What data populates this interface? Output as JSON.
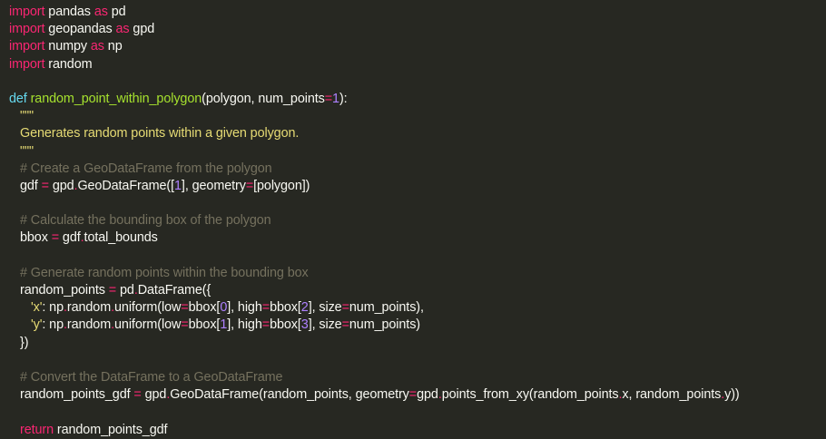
{
  "colors": {
    "background": "#272822",
    "text": "#f8f8f2",
    "keyword": "#f92672",
    "definition": "#66d9ef",
    "function": "#a6e22e",
    "number": "#ae81ff",
    "string": "#e6db74",
    "comment": "#75715e"
  },
  "lines": [
    [
      {
        "c": "kw",
        "t": "import"
      },
      {
        "c": "pl",
        "t": " pandas "
      },
      {
        "c": "kw",
        "t": "as"
      },
      {
        "c": "pl",
        "t": " pd"
      }
    ],
    [
      {
        "c": "kw",
        "t": "import"
      },
      {
        "c": "pl",
        "t": " geopandas "
      },
      {
        "c": "kw",
        "t": "as"
      },
      {
        "c": "pl",
        "t": " gpd"
      }
    ],
    [
      {
        "c": "kw",
        "t": "import"
      },
      {
        "c": "pl",
        "t": " numpy "
      },
      {
        "c": "kw",
        "t": "as"
      },
      {
        "c": "pl",
        "t": " np"
      }
    ],
    [
      {
        "c": "kw",
        "t": "import"
      },
      {
        "c": "pl",
        "t": " random"
      }
    ],
    [],
    [
      {
        "c": "def",
        "t": "def "
      },
      {
        "c": "fn",
        "t": "random_point_within_polygon"
      },
      {
        "c": "pl",
        "t": "(polygon, num_points"
      },
      {
        "c": "op",
        "t": "="
      },
      {
        "c": "num",
        "t": "1"
      },
      {
        "c": "pl",
        "t": "):"
      }
    ],
    [
      {
        "c": "str",
        "t": "\"\"\"",
        "i": 1
      }
    ],
    [
      {
        "c": "str",
        "t": "Generates random points within a given polygon.",
        "i": 1
      }
    ],
    [
      {
        "c": "str",
        "t": "\"\"\"",
        "i": 1
      }
    ],
    [
      {
        "c": "cm",
        "t": "# Create a GeoDataFrame from the polygon",
        "i": 1
      }
    ],
    [
      {
        "c": "pl",
        "t": "gdf ",
        "i": 1
      },
      {
        "c": "op",
        "t": "="
      },
      {
        "c": "pl",
        "t": " gpd"
      },
      {
        "c": "op",
        "t": "."
      },
      {
        "c": "pl",
        "t": "GeoDataFrame(["
      },
      {
        "c": "num",
        "t": "1"
      },
      {
        "c": "pl",
        "t": "], geometry"
      },
      {
        "c": "op",
        "t": "="
      },
      {
        "c": "pl",
        "t": "[polygon])"
      }
    ],
    [],
    [
      {
        "c": "cm",
        "t": "# Calculate the bounding box of the polygon",
        "i": 1
      }
    ],
    [
      {
        "c": "pl",
        "t": "bbox ",
        "i": 1
      },
      {
        "c": "op",
        "t": "="
      },
      {
        "c": "pl",
        "t": " gdf"
      },
      {
        "c": "op",
        "t": "."
      },
      {
        "c": "pl",
        "t": "total_bounds"
      }
    ],
    [],
    [
      {
        "c": "cm",
        "t": "# Generate random points within the bounding box",
        "i": 1
      }
    ],
    [
      {
        "c": "pl",
        "t": "random_points ",
        "i": 1
      },
      {
        "c": "op",
        "t": "="
      },
      {
        "c": "pl",
        "t": " pd"
      },
      {
        "c": "op",
        "t": "."
      },
      {
        "c": "pl",
        "t": "DataFrame({"
      }
    ],
    [
      {
        "c": "str",
        "t": "'x'",
        "i": 2
      },
      {
        "c": "pl",
        "t": ": np"
      },
      {
        "c": "op",
        "t": "."
      },
      {
        "c": "pl",
        "t": "random"
      },
      {
        "c": "op",
        "t": "."
      },
      {
        "c": "pl",
        "t": "uniform(low"
      },
      {
        "c": "op",
        "t": "="
      },
      {
        "c": "pl",
        "t": "bbox["
      },
      {
        "c": "num",
        "t": "0"
      },
      {
        "c": "pl",
        "t": "], high"
      },
      {
        "c": "op",
        "t": "="
      },
      {
        "c": "pl",
        "t": "bbox["
      },
      {
        "c": "num",
        "t": "2"
      },
      {
        "c": "pl",
        "t": "], size"
      },
      {
        "c": "op",
        "t": "="
      },
      {
        "c": "pl",
        "t": "num_points),"
      }
    ],
    [
      {
        "c": "str",
        "t": "'y'",
        "i": 2
      },
      {
        "c": "pl",
        "t": ": np"
      },
      {
        "c": "op",
        "t": "."
      },
      {
        "c": "pl",
        "t": "random"
      },
      {
        "c": "op",
        "t": "."
      },
      {
        "c": "pl",
        "t": "uniform(low"
      },
      {
        "c": "op",
        "t": "="
      },
      {
        "c": "pl",
        "t": "bbox["
      },
      {
        "c": "num",
        "t": "1"
      },
      {
        "c": "pl",
        "t": "], high"
      },
      {
        "c": "op",
        "t": "="
      },
      {
        "c": "pl",
        "t": "bbox["
      },
      {
        "c": "num",
        "t": "3"
      },
      {
        "c": "pl",
        "t": "], size"
      },
      {
        "c": "op",
        "t": "="
      },
      {
        "c": "pl",
        "t": "num_points)"
      }
    ],
    [
      {
        "c": "pl",
        "t": "})",
        "i": 1
      }
    ],
    [],
    [
      {
        "c": "cm",
        "t": "# Convert the DataFrame to a GeoDataFrame",
        "i": 1
      }
    ],
    [
      {
        "c": "pl",
        "t": "random_points_gdf ",
        "i": 1
      },
      {
        "c": "op",
        "t": "="
      },
      {
        "c": "pl",
        "t": " gpd"
      },
      {
        "c": "op",
        "t": "."
      },
      {
        "c": "pl",
        "t": "GeoDataFrame(random_points, geometry"
      },
      {
        "c": "op",
        "t": "="
      },
      {
        "c": "pl",
        "t": "gpd"
      },
      {
        "c": "op",
        "t": "."
      },
      {
        "c": "pl",
        "t": "points_from_xy(random_points"
      },
      {
        "c": "op",
        "t": "."
      },
      {
        "c": "pl",
        "t": "x, random_points"
      },
      {
        "c": "op",
        "t": "."
      },
      {
        "c": "pl",
        "t": "y))"
      }
    ],
    [],
    [
      {
        "c": "kw",
        "t": "return",
        "i": 1
      },
      {
        "c": "pl",
        "t": " random_points_gdf"
      }
    ]
  ]
}
